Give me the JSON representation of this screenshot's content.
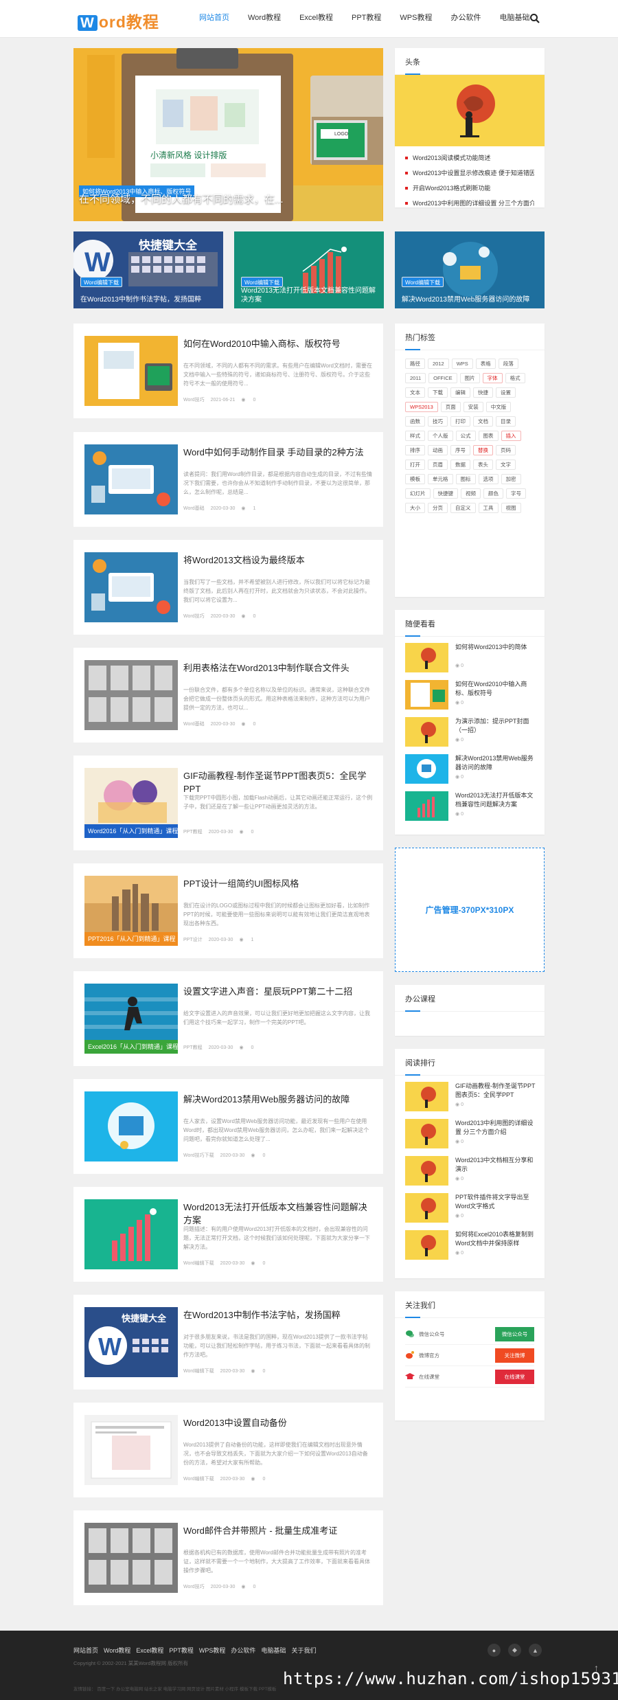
{
  "header": {
    "logo_w": "W",
    "logo_text": "ord教程",
    "nav": [
      "网站首页",
      "Word教程",
      "Excel教程",
      "PPT教程",
      "WPS教程",
      "办公软件",
      "电脑基础"
    ]
  },
  "banner": {
    "badge": "如何将Word2013中输入商标、版权符号",
    "caption": "在不同领域，不同的人都有不同的需求，在..."
  },
  "mini_cards": [
    {
      "tag": "Word编辑下载",
      "title": "在Word2013中制作书法字帖，发扬国粹",
      "thumb_text": "快捷键大全"
    },
    {
      "tag": "Word编辑下载",
      "title": "Word2013无法打开低版本文档兼容性问题解决方案"
    },
    {
      "tag": "Word编辑下载",
      "title": "解决Word2013禁用Web服务器访问的故障"
    }
  ],
  "headline": {
    "heading": "头条",
    "items": [
      "Word2013阅读模式功能简述",
      "Word2013中设置显示修改痕迹 便于知道错因",
      "开启Word2013格式刷新功能",
      "Word2013中利用图的详细设置 分三个方面介绍"
    ]
  },
  "articles": [
    {
      "title": "如何在Word2010中输入商标、版权符号",
      "desc": "在不同领域，不同的人都有不同的需求。有些用户在编辑Word文档时，需要在文档中输入一些特殊的符号，诸如商标符号、注册符号、版权符号。介于这些符号不太一般的使用符号...",
      "cat": "Word技巧",
      "date": "2021-06-21",
      "views": "0"
    },
    {
      "title": "Word中如何手动制作目录 手动目录的2种方法",
      "desc": "读者提问：我们用Word制作目录，都是根据内容自动生成的目录，不过有些情况下我们需要，也许你会从不知道制作手动制作目录，不要以为这很简单，那么，怎么制作呢，总结是...",
      "cat": "Word基础",
      "date": "2020-03-30",
      "views": "1"
    },
    {
      "title": "将Word2013文档设为最终版本",
      "desc": "当我们写了一些文档，并不希望被别人进行修改，所以我们可以将它标记为最终版了文档，此后别人再在打开时，此文档就会为只读状态，不会对此操作。我们可以将它设置为...",
      "cat": "Word技巧",
      "date": "2020-03-30",
      "views": "0"
    },
    {
      "title": "利用表格法在Word2013中制作联合文件头",
      "desc": "一份联合文件，都有多个单位名称以及单位的标识。通常来说，这种联合文件会把它做成一份整体页头的形式。用这种表格法来制作，这种方法可以为用户提供一定的方法，也可以...",
      "cat": "Word基础",
      "date": "2020-03-30",
      "views": "0"
    },
    {
      "title": "GIF动画教程-制作圣诞节PPT图表页5：全民学PPT",
      "desc": "下载完PPT中圆形小图，加载Flash动画后，让其它动画还能正常运行，这个例子中，我们还是在了解一些让PPT动画更加灵活的方法。",
      "cat": "PPT教程",
      "date": "2020-03-30",
      "views": "0",
      "course": "Word2016「从入门到精通」课程",
      "course_color": "#1e62c7"
    },
    {
      "title": "PPT设计一组简约UI图标风格",
      "desc": "我们在设计的LOGO或图标过程中我们的时候都会让图标更加好看，比如制作PPT的时候，可能要使用一些图标来说明可以能有效地让我们更简洁直观地表现出各种东西。",
      "cat": "PPT设计",
      "date": "2020-03-30",
      "views": "1",
      "course": "PPT2016「从入门到精通」课程",
      "course_color": "#f08c1f"
    },
    {
      "title": "设置文字进入声音：星辰玩PPT第二十二招",
      "desc": "给文字设置进入的声音效果，可以让我们更好地更加把握这么文字内容，让我们用这个技巧来一起学习，制作一个完美的PPT吧。",
      "cat": "PPT教程",
      "date": "2020-03-30",
      "views": "0",
      "course": "Excel2016「从入门到精通」课程",
      "course_color": "#3aa53a"
    },
    {
      "title": "解决Word2013禁用Web服务器访问的故障",
      "desc": "在人家去，设置Word禁用Web服务器访问功能，最近发现有一些用户在使用Word时，都出现Word禁用Web服务器访问，怎么办呢，我们来一起解决这个问题吧，看完你就知道怎么处理了...",
      "cat": "Word技巧下载",
      "date": "2020-03-30",
      "views": "0"
    },
    {
      "title": "Word2013无法打开低版本文档兼容性问题解决方案",
      "desc": "问题描述：有的用户使用Word2013打开低版本的文档时，会出现兼容性的问题，无法正常打开文档，这个时候我们该如何处理呢，下面就为大家分享一下解决方法。",
      "cat": "Word编辑下载",
      "date": "2020-03-30",
      "views": "0"
    },
    {
      "title": "在Word2013中制作书法字帖，发扬国粹",
      "desc": "对于很多朋友来说，书法是我们的国粹，现在Word2013提供了一款书法字帖功能，可以让我们轻松制作字帖，用于练习书法，下面就一起来看看具体的制作方法吧。",
      "cat": "Word编辑下载",
      "date": "2020-03-30",
      "views": "0",
      "thumb_text": "快捷键大全"
    },
    {
      "title": "Word2013中设置自动备份",
      "desc": "Word2013提供了自动备份的功能，这样即使我们在编辑文档时出现意外情况，也不会导致文档丢失，下面就为大家介绍一下如何设置Word2013自动备份的方法，希望对大家有所帮助。",
      "cat": "Word编辑下载",
      "date": "2020-03-30",
      "views": "0"
    },
    {
      "title": "Word邮件合并带照片 - 批量生成准考证",
      "desc": "根据各机构已有的数据库，使用Word邮件合并功能批量生成带有照片的准考证，这样就不需要一个一个地制作，大大提高了工作效率，下面就来看看具体操作步骤吧。",
      "cat": "Word技巧",
      "date": "2020-03-30",
      "views": "0"
    }
  ],
  "hot_tags": {
    "heading": "热门标签",
    "tags": [
      "路径",
      "2012",
      "WPS",
      "表格",
      "段落",
      "2011",
      "OFFICE",
      "图片",
      "字体",
      "格式",
      "文本",
      "下载",
      "编辑",
      "快捷",
      "设置",
      "WPS2013",
      "页面",
      "安装",
      "中文版",
      "函数",
      "技巧",
      "打印",
      "文档",
      "目录",
      "样式",
      "个人版",
      "公式",
      "图表",
      "插入",
      "排序",
      "动画",
      "序号",
      "替换",
      "页码",
      "打开",
      "页眉",
      "数据",
      "表头",
      "文字",
      "模板",
      "单元格",
      "图标",
      "选项",
      "加密",
      "幻灯片",
      "快捷键",
      "视频",
      "颜色",
      "字号",
      "大小",
      "分页",
      "自定义",
      "工具",
      "视图"
    ],
    "red": [
      "字体",
      "WPS2013",
      "插入",
      "替换"
    ]
  },
  "recommend": {
    "heading": "随便看看",
    "items": [
      {
        "title": "如何将Word2013中的简体",
        "views": "0"
      },
      {
        "title": "如何在Word2010中输入商标、版权符号",
        "views": "0"
      },
      {
        "title": "为演示添加：提示PPT封面（一招）",
        "views": "0"
      },
      {
        "title": "解决Word2013禁用Web服务器访问的故障",
        "views": "0"
      },
      {
        "title": "Word2013无法打开低版本文档兼容性问题解决方案",
        "views": "0"
      }
    ]
  },
  "ad": {
    "text": "广告管理-370PX*310PX"
  },
  "office": {
    "heading": "办公课程"
  },
  "ranking": {
    "heading": "阅读排行",
    "items": [
      {
        "title": "GIF动画教程-制作圣诞节PPT图表页5：全民学PPT",
        "views": "0"
      },
      {
        "title": "Word2013中利用图的详细设置 分三个方面介绍",
        "views": "0"
      },
      {
        "title": "Word2013中文档相互分享和演示",
        "views": "0"
      },
      {
        "title": "PPT软件插件将文字导出至Word文字格式",
        "views": "0"
      },
      {
        "title": "如何将Excel2010表格复制到Word文档中并保持原样",
        "views": "0"
      }
    ]
  },
  "follow": {
    "heading": "关注我们",
    "rows": [
      {
        "label": "微信公众号",
        "button": "微信公众号",
        "color": "#2aa35a"
      },
      {
        "label": "微博官方",
        "button": "关注微博",
        "color": "#f04a22"
      },
      {
        "label": "在线课堂",
        "button": "在线课堂",
        "color": "#e02a3a"
      }
    ]
  },
  "footer": {
    "nav": [
      "网站首页",
      "Word教程",
      "Excel教程",
      "PPT教程",
      "WPS教程",
      "办公软件",
      "电脑基础",
      "关于我们"
    ],
    "copyright": "Copyright © 2002-2021 某某Word教程网 版权所有",
    "bottom_line": "友情链接： 百度一下  办公室电脑网  站长之家  电脑学习网  网页设计  图片素材  小程序  模板下载  PPT模板",
    "watermark": "https://www.huzhan.com/ishop15931"
  }
}
